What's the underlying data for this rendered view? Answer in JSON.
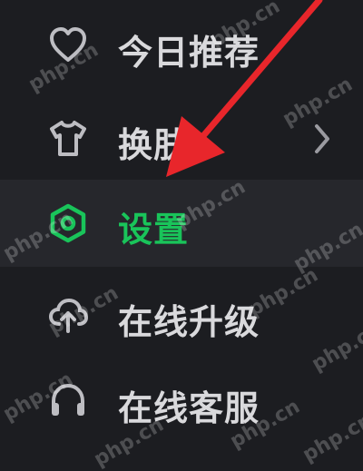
{
  "menu": {
    "items": [
      {
        "label": "今日推荐",
        "icon": "heart-icon"
      },
      {
        "label": "换肤",
        "icon": "tshirt-icon",
        "chevron": "chevron-right-icon"
      },
      {
        "label": "设置",
        "icon": "hexagon-settings-icon",
        "active": true
      },
      {
        "label": "在线升级",
        "icon": "cloud-upload-icon"
      },
      {
        "label": "在线客服",
        "icon": "headset-icon"
      }
    ]
  },
  "watermark": "php.cn",
  "colors": {
    "background": "#1c1d21",
    "active_background": "#26272c",
    "active_text": "#19c45a",
    "text": "#d9d9dc",
    "icon": "#bdbdc2",
    "arrow": "#e8262b"
  }
}
